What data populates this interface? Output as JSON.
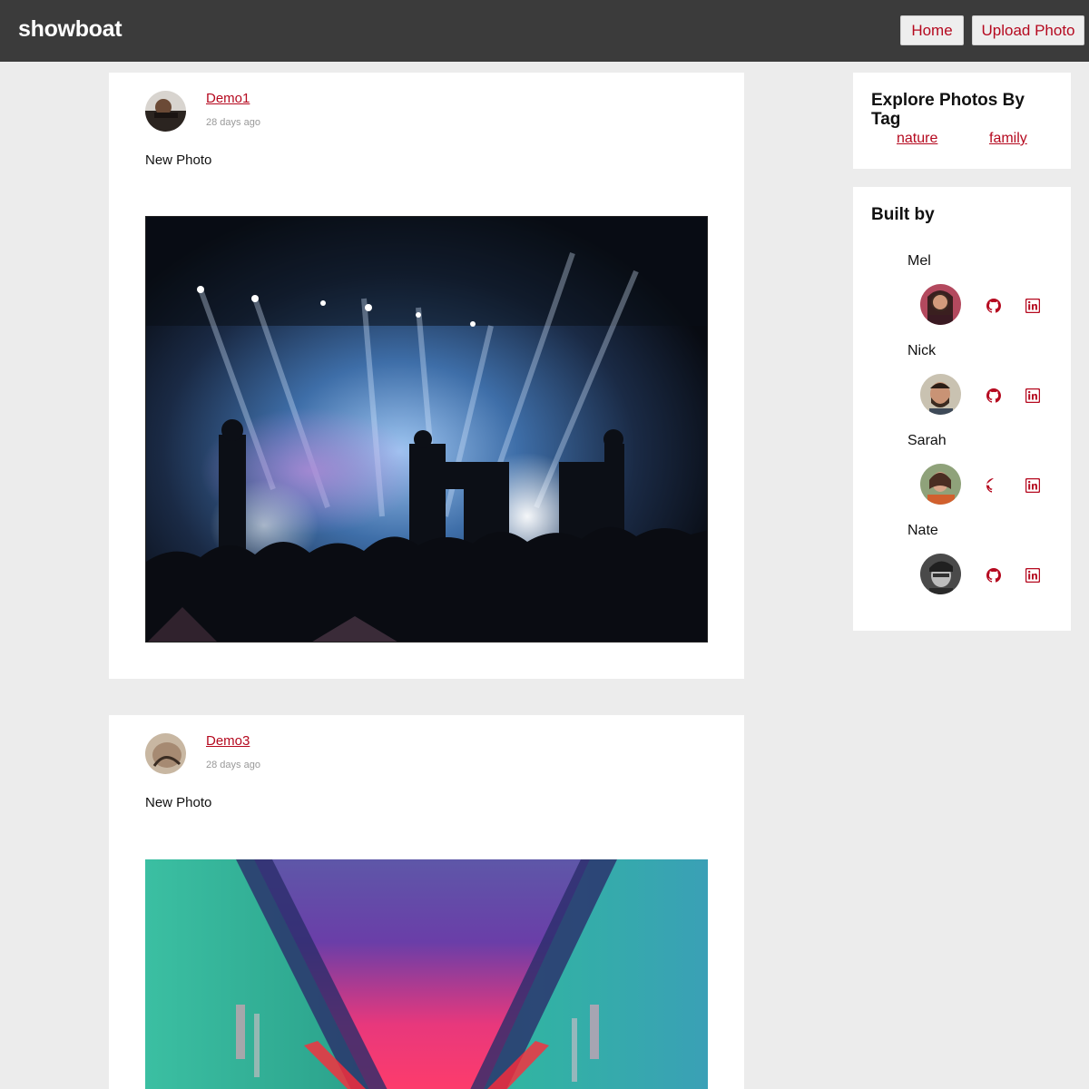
{
  "header": {
    "brand": "showboat",
    "nav": {
      "home": "Home",
      "upload": "Upload Photo"
    }
  },
  "posts": [
    {
      "author": "Demo1",
      "time": "28 days ago",
      "caption": "New Photo",
      "photo": "concert-stage-photo"
    },
    {
      "author": "Demo3",
      "time": "28 days ago",
      "caption": "New Photo",
      "photo": "neon-tunnel-photo"
    }
  ],
  "sidebar": {
    "tags": {
      "title": "Explore Photos By Tag",
      "items": [
        "nature",
        "family"
      ]
    },
    "built_by": {
      "title": "Built by",
      "people": [
        {
          "name": "Mel"
        },
        {
          "name": "Nick"
        },
        {
          "name": "Sarah"
        },
        {
          "name": "Nate"
        }
      ]
    }
  },
  "colors": {
    "topbar": "#3b3b3b",
    "accent": "#b5091f",
    "background": "#ececec",
    "card": "#ffffff"
  },
  "icons": [
    "github-icon",
    "linkedin-icon"
  ]
}
